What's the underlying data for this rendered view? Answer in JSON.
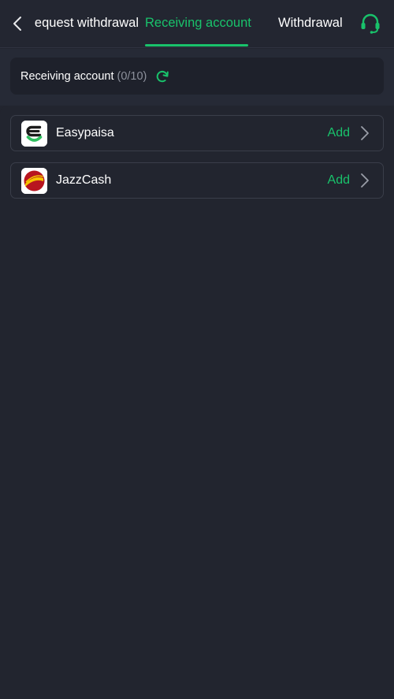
{
  "header": {
    "tabs": [
      {
        "label": "Request withdrawal"
      },
      {
        "label": "Receiving account",
        "active": true
      },
      {
        "label": "Withdrawal history"
      }
    ],
    "back_icon": "chevron-left-icon",
    "support_icon": "headset-icon"
  },
  "summary": {
    "label": "Receiving account",
    "count": "(0/10)",
    "refresh_icon": "refresh-icon"
  },
  "methods": [
    {
      "name": "Easypaisa",
      "action": "Add",
      "logo": "easypaisa-logo"
    },
    {
      "name": "JazzCash",
      "action": "Add",
      "logo": "jazzcash-logo"
    }
  ],
  "colors": {
    "accent": "#19c26b",
    "background": "#22252f",
    "card": "#1e212b",
    "border": "#3a3e4a",
    "muted": "#8d919c"
  }
}
